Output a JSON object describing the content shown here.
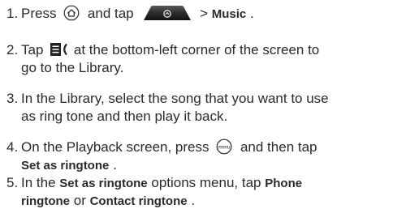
{
  "steps": [
    {
      "number": "1.",
      "lines": [
        {
          "t1": "Press ",
          "t2": " and tap ",
          "t3": " > ",
          "t4": "Music",
          "t5": "."
        }
      ]
    },
    {
      "number": "2.",
      "lines": [
        {
          "t1": "Tap ",
          "t2": " at the bottom-left corner of the screen to"
        },
        {
          "t1": "go to the Library."
        }
      ]
    },
    {
      "number": "3.",
      "lines": [
        {
          "t1": "In the Library, select the song that you want to use"
        },
        {
          "t1": "as ring tone and then play it back."
        }
      ]
    },
    {
      "number": "4.",
      "lines": [
        {
          "t1": "On the Playback screen, press ",
          "t2": " and then tap"
        },
        {
          "t1": "Set as ringtone",
          "t2": "."
        }
      ]
    },
    {
      "number": "5.",
      "lines": [
        {
          "t1": "In the ",
          "t2": "Set as ringtone",
          "t3": " options menu, tap ",
          "t4": "Phone"
        },
        {
          "t1": "ringtone",
          "t2": " or ",
          "t3": "Contact ringtone",
          "t4": "."
        }
      ]
    }
  ],
  "icons": {
    "home": "home-key-icon",
    "apps_tab": "all-apps-tab-icon",
    "library": "library-icon",
    "menu": "menu-key-icon",
    "menu_key_text": "menu"
  }
}
